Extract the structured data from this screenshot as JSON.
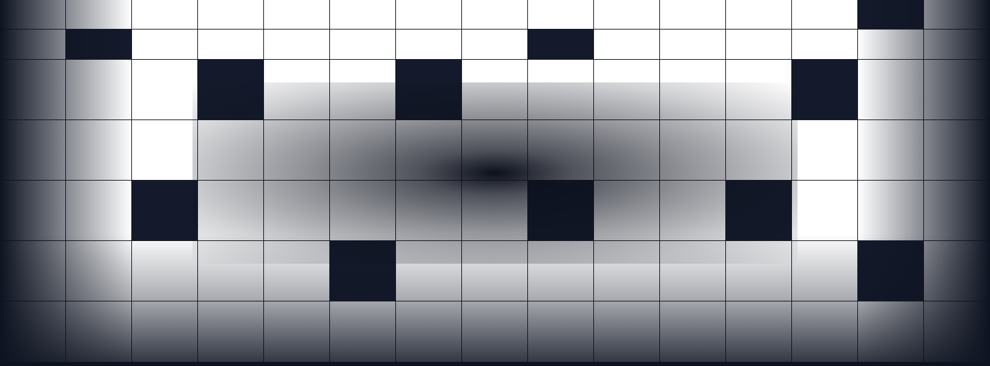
{
  "board": {
    "rows": 7,
    "cols": 15,
    "colors": {
      "empty": "#ffffff",
      "filled": "#141a2b",
      "grid_line": "#1a1d27",
      "background": "#0e1321"
    },
    "cells": [
      [
        0,
        0,
        0,
        0,
        0,
        0,
        0,
        0,
        0,
        0,
        0,
        0,
        0,
        1,
        0
      ],
      [
        0,
        1,
        0,
        0,
        0,
        0,
        0,
        0,
        1,
        0,
        0,
        0,
        0,
        0,
        0
      ],
      [
        0,
        0,
        0,
        1,
        0,
        0,
        1,
        0,
        0,
        0,
        0,
        0,
        1,
        0,
        0
      ],
      [
        0,
        0,
        0,
        0,
        0,
        0,
        0,
        0,
        0,
        0,
        0,
        0,
        0,
        0,
        0
      ],
      [
        0,
        0,
        1,
        0,
        0,
        0,
        0,
        0,
        1,
        0,
        0,
        1,
        0,
        0,
        0
      ],
      [
        0,
        0,
        0,
        0,
        0,
        1,
        0,
        0,
        0,
        0,
        0,
        0,
        0,
        1,
        0
      ],
      [
        0,
        0,
        0,
        0,
        0,
        0,
        0,
        0,
        0,
        0,
        0,
        0,
        0,
        0,
        0
      ]
    ]
  }
}
